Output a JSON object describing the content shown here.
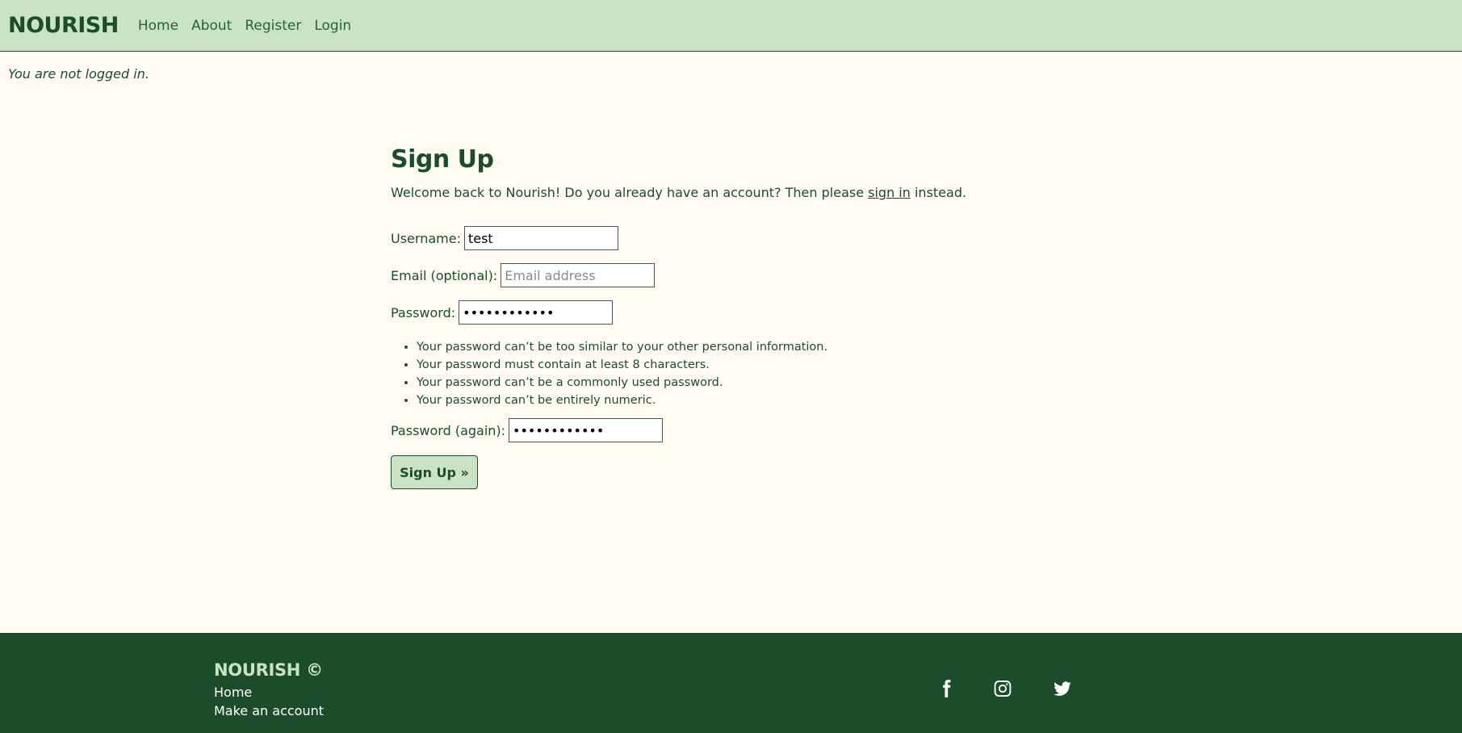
{
  "header": {
    "brand": "NOURISH",
    "nav": [
      "Home",
      "About",
      "Register",
      "Login"
    ]
  },
  "status_text": "You are not logged in.",
  "form": {
    "title": "Sign Up",
    "welcome_prefix": "Welcome back to Nourish! Do you already have an account? Then please ",
    "welcome_link": "sign in",
    "welcome_suffix": " instead.",
    "username_label": "Username:",
    "username_value": "test",
    "email_label": "Email (optional):",
    "email_placeholder": "Email address",
    "password_label": "Password:",
    "password_value": "••••••••••••",
    "password_rules": [
      "Your password can’t be too similar to your other personal information.",
      "Your password must contain at least 8 characters.",
      "Your password can’t be a commonly used password.",
      "Your password can’t be entirely numeric."
    ],
    "password2_label": "Password (again):",
    "password2_value": "••••••••••••",
    "submit_label": "Sign Up »"
  },
  "footer": {
    "brand": "NOURISH ©",
    "links": [
      "Home",
      "Make an account"
    ],
    "social_icons": [
      "facebook-icon",
      "instagram-icon",
      "twitter-icon"
    ]
  },
  "colors": {
    "header_bg": "#c9e3c4",
    "page_bg": "#fffbf3",
    "primary": "#1b4d2b"
  }
}
